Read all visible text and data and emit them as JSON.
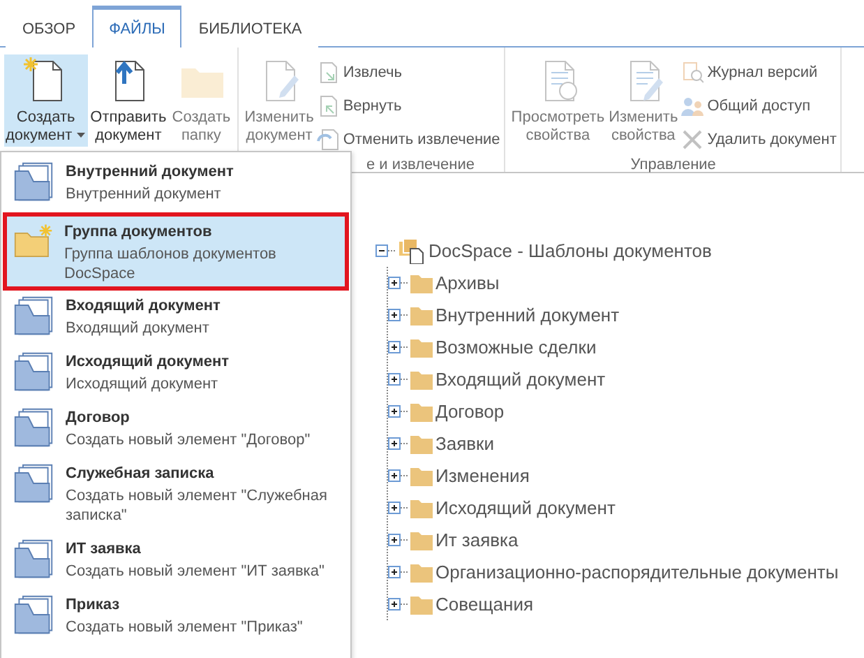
{
  "tabs": [
    {
      "label": "ОБЗОР",
      "selected": false
    },
    {
      "label": "ФАЙЛЫ",
      "selected": true
    },
    {
      "label": "БИБЛИОТЕКА",
      "selected": false
    }
  ],
  "ribbon": {
    "groups": [
      {
        "large": [
          {
            "lines": [
              "Создать",
              "документ"
            ],
            "dropdown": true,
            "pressed": true,
            "disabled": false
          },
          {
            "lines": [
              "Отправить",
              "документ"
            ],
            "dropdown": false,
            "pressed": false,
            "disabled": false
          },
          {
            "lines": [
              "Создать",
              "папку"
            ],
            "dropdown": false,
            "pressed": false,
            "disabled": true
          }
        ]
      },
      {
        "label": "е и извлечение",
        "large": [
          {
            "lines": [
              "Изменить",
              "документ"
            ],
            "dropdown": false,
            "pressed": false,
            "disabled": true
          }
        ],
        "small": [
          {
            "label": "Извлечь",
            "disabled": true
          },
          {
            "label": "Вернуть",
            "disabled": true
          },
          {
            "label": "Отменить извлечение",
            "disabled": true
          }
        ]
      },
      {
        "label": "Управление",
        "large": [
          {
            "lines": [
              "Просмотреть",
              "свойства"
            ],
            "dropdown": false,
            "pressed": false,
            "disabled": true
          },
          {
            "lines": [
              "Изменить",
              "свойства"
            ],
            "dropdown": false,
            "pressed": false,
            "disabled": true
          }
        ],
        "small": [
          {
            "label": "Журнал версий",
            "disabled": true
          },
          {
            "label": "Общий доступ",
            "disabled": true
          },
          {
            "label": "Удалить документ",
            "disabled": true
          }
        ]
      }
    ]
  },
  "menu": {
    "items": [
      {
        "kind": "docset",
        "title": "Внутренний документ",
        "description": "Внутренний документ",
        "selected": false
      },
      {
        "kind": "folder",
        "title": "Группа документов",
        "description": "Группа шаблонов документов DocSpace",
        "selected": true
      },
      {
        "kind": "docset",
        "title": "Входящий документ",
        "description": "Входящий документ",
        "selected": false
      },
      {
        "kind": "docset",
        "title": "Исходящий документ",
        "description": "Исходящий документ",
        "selected": false
      },
      {
        "kind": "docset",
        "title": "Договор",
        "description": "Создать новый элемент \"Договор\"",
        "selected": false
      },
      {
        "kind": "docset",
        "title": "Служебная записка",
        "description": "Создать новый элемент \"Служебная записка\"",
        "selected": false
      },
      {
        "kind": "docset",
        "title": "ИТ заявка",
        "description": "Создать новый элемент \"ИТ заявка\"",
        "selected": false
      },
      {
        "kind": "docset",
        "title": "Приказ",
        "description": "Создать новый элемент \"Приказ\"",
        "selected": false
      }
    ]
  },
  "tree": {
    "label": "DocSpace - Шаблоны документов",
    "expanded": true,
    "children": [
      {
        "label": "Архивы",
        "expanded": false
      },
      {
        "label": "Внутренний документ",
        "expanded": false
      },
      {
        "label": "Возможные сделки",
        "expanded": false
      },
      {
        "label": "Входящий документ",
        "expanded": false
      },
      {
        "label": "Договор",
        "expanded": false
      },
      {
        "label": "Заявки",
        "expanded": false
      },
      {
        "label": "Изменения",
        "expanded": false
      },
      {
        "label": "Исходящий документ",
        "expanded": false
      },
      {
        "label": "Ит заявка",
        "expanded": false
      },
      {
        "label": "Организационно-распорядительные документы",
        "expanded": false
      },
      {
        "label": "Совещания",
        "expanded": false
      }
    ]
  }
}
